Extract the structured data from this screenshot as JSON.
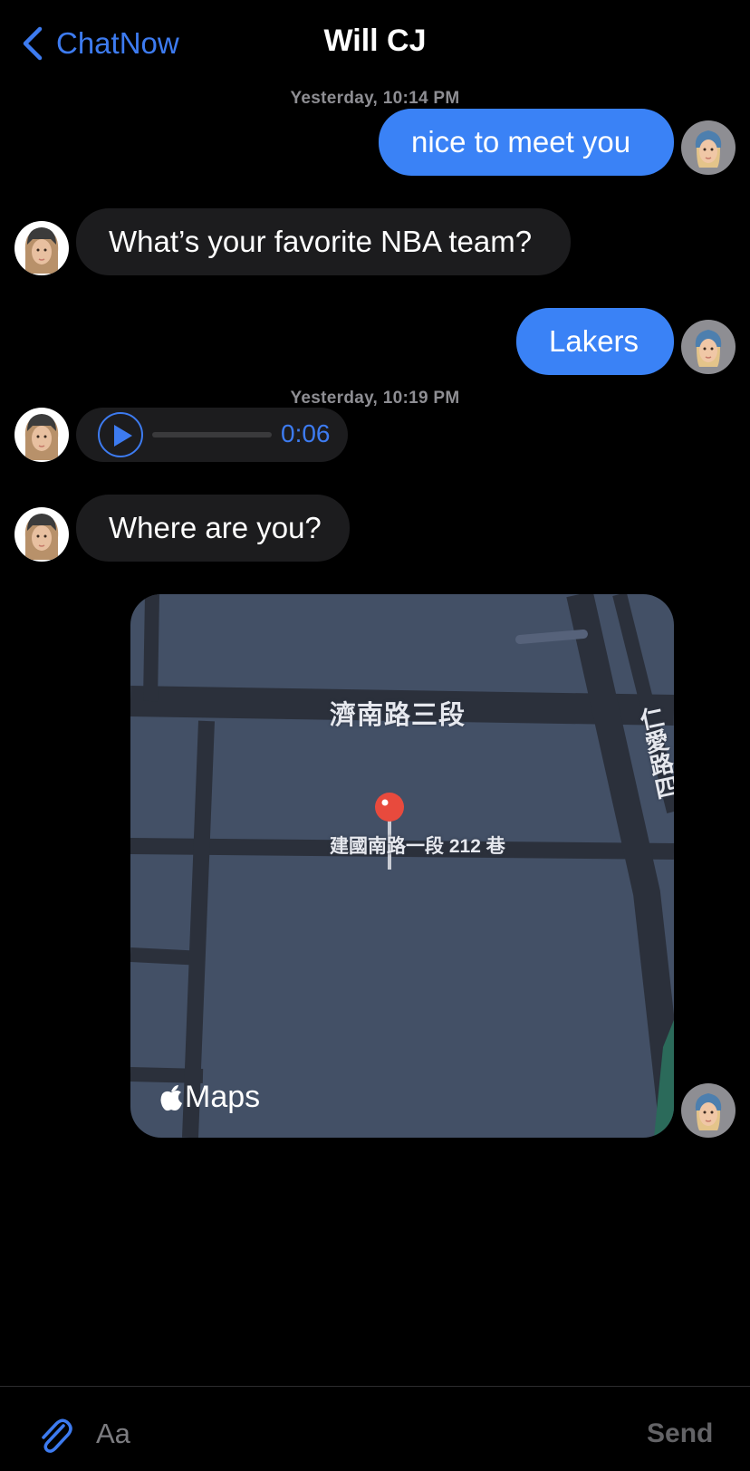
{
  "header": {
    "back_label": "ChatNow",
    "title": "Will CJ"
  },
  "timestamps": [
    "Yesterday, 10:14 PM",
    "Yesterday, 10:19 PM"
  ],
  "messages": [
    {
      "direction": "outgoing",
      "type": "text",
      "text": "nice to meet you"
    },
    {
      "direction": "incoming",
      "type": "text",
      "text": "What’s your favorite NBA team?"
    },
    {
      "direction": "outgoing",
      "type": "text",
      "text": "Lakers"
    },
    {
      "direction": "incoming",
      "type": "audio",
      "duration": "0:06"
    },
    {
      "direction": "incoming",
      "type": "text",
      "text": "Where are you?"
    },
    {
      "direction": "outgoing",
      "type": "location",
      "map": {
        "road_label_top": "濟南路三段",
        "pin_label": "建國南路一段 212 巷",
        "road_label_side": "仁愛路四",
        "brand": "Maps"
      }
    }
  ],
  "composer": {
    "placeholder": "Aa",
    "send_label": "Send"
  },
  "colors": {
    "accent": "#3d7bf0",
    "outgoing_bubble": "#3a82f6",
    "incoming_bubble": "#1c1c1e",
    "map_bg": "#435066"
  },
  "icons": [
    "chevron-left-icon",
    "play-icon",
    "map-pin-icon",
    "apple-logo-icon",
    "paperclip-icon"
  ]
}
